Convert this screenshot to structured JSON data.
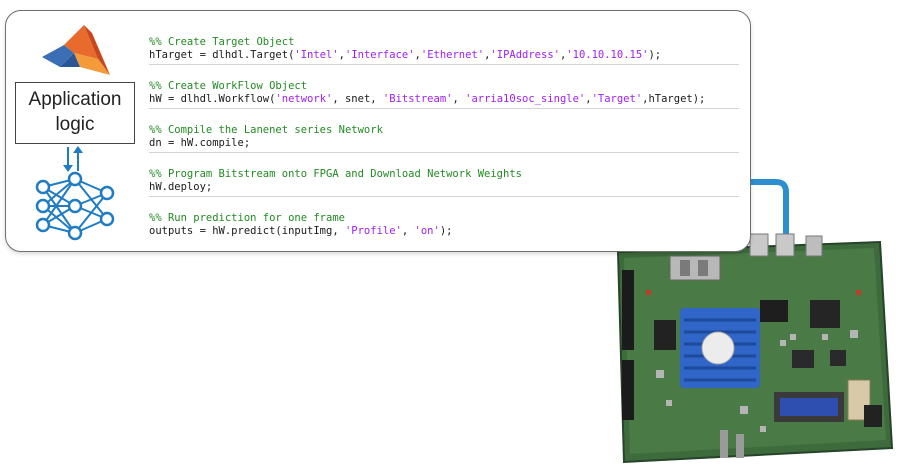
{
  "application_box": {
    "line1": "Application",
    "line2": "logic"
  },
  "code_blocks": [
    {
      "comment": "%% Create Target Object",
      "segments": [
        {
          "t": "hTarget = dlhdl.Target("
        },
        {
          "t": "'Intel'",
          "s": true
        },
        {
          "t": ","
        },
        {
          "t": "'Interface'",
          "s": true
        },
        {
          "t": ","
        },
        {
          "t": "'Ethernet'",
          "s": true
        },
        {
          "t": ","
        },
        {
          "t": "'IPAddress'",
          "s": true
        },
        {
          "t": ","
        },
        {
          "t": "'10.10.10.15'",
          "s": true
        },
        {
          "t": ");"
        }
      ]
    },
    {
      "comment": "%% Create WorkFlow Object",
      "segments": [
        {
          "t": "hW = dlhdl.Workflow("
        },
        {
          "t": "'network'",
          "s": true
        },
        {
          "t": ", snet, "
        },
        {
          "t": "'Bitstream'",
          "s": true
        },
        {
          "t": ", "
        },
        {
          "t": "'arria10soc_single'",
          "s": true
        },
        {
          "t": ","
        },
        {
          "t": "'Target'",
          "s": true
        },
        {
          "t": ",hTarget);"
        }
      ]
    },
    {
      "comment": "%% Compile the Lanenet series Network",
      "segments": [
        {
          "t": "dn = hW.compile;"
        }
      ]
    },
    {
      "comment": "%% Program Bitstream onto FPGA and Download Network Weights",
      "segments": [
        {
          "t": "hW.deploy;"
        }
      ]
    },
    {
      "comment": "%% Run prediction for one frame",
      "segments": [
        {
          "t": "outputs = hW.predict(inputImg, "
        },
        {
          "t": "'Profile'",
          "s": true
        },
        {
          "t": ", "
        },
        {
          "t": "'on'",
          "s": true
        },
        {
          "t": ");"
        }
      ]
    }
  ],
  "colors": {
    "comment": "#228b22",
    "string": "#a020f0",
    "cable": "#2b8fd0",
    "icon_blue": "#1f7cc4",
    "pcb": "#3e6b3c",
    "heatsink": "#2f66c8"
  },
  "icons": [
    "matlab-logo-icon",
    "bidirectional-arrows-icon",
    "neural-network-icon",
    "fpga-board-image"
  ]
}
